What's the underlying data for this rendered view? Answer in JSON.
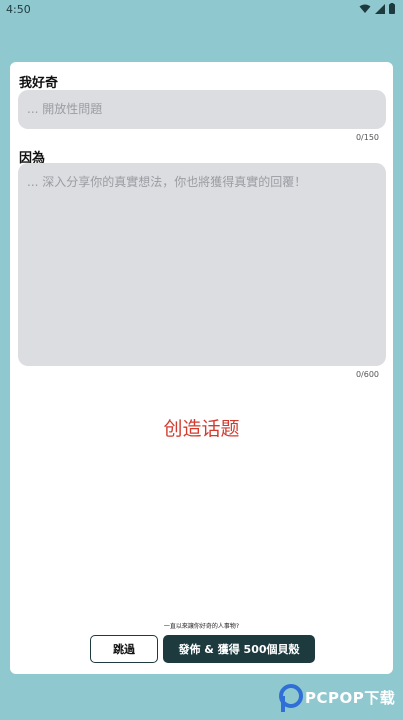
{
  "status": {
    "time": "4:50"
  },
  "form": {
    "question_label": "我好奇",
    "question_placeholder": "... 開放性問題",
    "question_counter": "0/150",
    "reason_label": "因為",
    "reason_placeholder": "... 深入分享你的真實想法，你也將獲得真實的回覆！",
    "reason_counter": "0/600"
  },
  "main": {
    "create_topic": "创造话题"
  },
  "footer": {
    "hint": "一直以來讓你好奇的人事物?",
    "skip_label": "跳過",
    "post_label": "發佈 & 獲得 500個貝殼"
  },
  "watermark": {
    "text": "PCPOP下载"
  },
  "colors": {
    "accent": "#1d3b3f",
    "background": "#90c8cf",
    "field": "#dcdde1",
    "create": "#d33b2f"
  }
}
